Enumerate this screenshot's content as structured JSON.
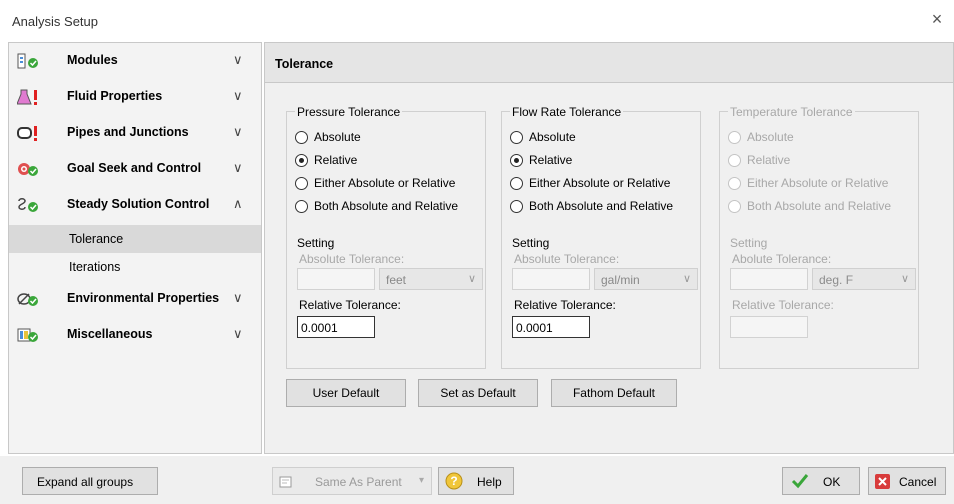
{
  "window": {
    "title": "Analysis Setup",
    "close_glyph": "×"
  },
  "sidebar": {
    "groups": [
      {
        "label": "Modules",
        "icon": "modules-icon",
        "chevron": "∨"
      },
      {
        "label": "Fluid Properties",
        "icon": "flask-warning-icon",
        "chevron": "∨"
      },
      {
        "label": "Pipes and Junctions",
        "icon": "pipe-warning-icon",
        "chevron": "∨"
      },
      {
        "label": "Goal Seek and Control",
        "icon": "target-icon",
        "chevron": "∨"
      },
      {
        "label": "Steady Solution Control",
        "icon": "solution-icon",
        "chevron": "∧"
      },
      {
        "label": "Environmental Properties",
        "icon": "environment-icon",
        "chevron": "∨"
      },
      {
        "label": "Miscellaneous",
        "icon": "misc-icon",
        "chevron": "∨"
      }
    ],
    "subitems": [
      {
        "label": "Tolerance",
        "selected": true
      },
      {
        "label": "Iterations",
        "selected": false
      }
    ]
  },
  "panel": {
    "title": "Tolerance",
    "setting_label": "Setting",
    "absolute_label": "Absolute Tolerance:",
    "relative_label": "Relative Tolerance:",
    "pressure": {
      "legend": "Pressure Tolerance",
      "options": [
        "Absolute",
        "Relative",
        "Either Absolute or Relative",
        "Both Absolute and Relative"
      ],
      "selected": "Relative",
      "unit": "feet",
      "relative_value": "0.0001",
      "absolute_value": ""
    },
    "flow": {
      "legend": "Flow Rate Tolerance",
      "options": [
        "Absolute",
        "Relative",
        "Either Absolute or Relative",
        "Both Absolute and Relative"
      ],
      "selected": "Relative",
      "unit": "gal/min",
      "relative_value": "0.0001",
      "absolute_value": ""
    },
    "temperature": {
      "legend": "Temperature Tolerance",
      "options": [
        "Absolute",
        "Relative",
        "Either Absolute or Relative",
        "Both Absolute and Relative"
      ],
      "unit": "deg. F",
      "setting_label": "Setting",
      "absolute_label": "Abolute Tolerance:",
      "relative_label": "Relative Tolerance:",
      "disabled": true
    },
    "buttons": {
      "user_default": "User Default",
      "set_as_default": "Set as Default",
      "fathom_default": "Fathom Default"
    }
  },
  "footer": {
    "expand_all": "Expand all groups",
    "same_as_parent": "Same As Parent",
    "help": "Help",
    "ok": "OK",
    "cancel": "Cancel"
  },
  "colors": {
    "check_green": "#3aa63a",
    "warning_red": "#e02020",
    "cancel_red": "#d83b3b"
  }
}
